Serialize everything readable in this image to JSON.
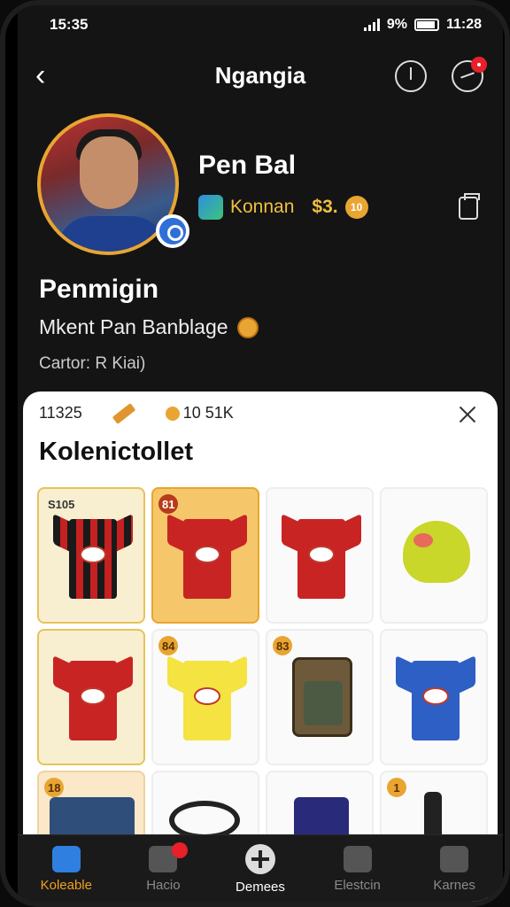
{
  "status": {
    "time": "15:35",
    "battery": "9%",
    "clock_right": "11:28"
  },
  "nav": {
    "title": "Ngangia"
  },
  "profile": {
    "name": "Pen Bal",
    "team": "Konnan",
    "coins": "$3.",
    "coin_value": "10",
    "display_name": "Penmigin",
    "bio": "Mkent Pan Banblage",
    "subtitle": "Cartor: R Kiai)"
  },
  "collection": {
    "count": "11325",
    "coins": "10 51K",
    "title": "Kolenictollet",
    "items": [
      {
        "badge": "S105",
        "kind": "jersey",
        "colors": "stripes",
        "tile": "gold"
      },
      {
        "badge": "81",
        "kind": "jersey",
        "colors": "red",
        "tile": "orange"
      },
      {
        "badge": "",
        "kind": "jersey",
        "colors": "red",
        "tile": "plain"
      },
      {
        "badge": "",
        "kind": "monster",
        "colors": "",
        "tile": "plain"
      },
      {
        "badge": "",
        "kind": "jersey",
        "colors": "red",
        "tile": "gold"
      },
      {
        "badge": "84",
        "kind": "jersey",
        "colors": "yellow",
        "tile": "plain"
      },
      {
        "badge": "83",
        "kind": "bag",
        "colors": "",
        "tile": "plain"
      },
      {
        "badge": "",
        "kind": "jersey",
        "colors": "blue",
        "tile": "plain"
      },
      {
        "badge": "18",
        "kind": "shorts",
        "colors": "",
        "tile": "peach"
      },
      {
        "badge": "",
        "kind": "cable",
        "colors": "",
        "tile": "plain"
      },
      {
        "badge": "",
        "kind": "bag2",
        "colors": "",
        "tile": "plain"
      },
      {
        "badge": "1",
        "kind": "bottle",
        "colors": "",
        "tile": "plain"
      }
    ]
  },
  "tabs": [
    {
      "label": "Koleable",
      "icon": "collection-icon",
      "active": true
    },
    {
      "label": "Hacio",
      "icon": "activity-icon",
      "active": false
    },
    {
      "label": "Demees",
      "icon": "add-icon",
      "active": false
    },
    {
      "label": "Elestcin",
      "icon": "inbox-icon",
      "active": false
    },
    {
      "label": "Karnes",
      "icon": "games-icon",
      "active": false
    }
  ],
  "colors": {
    "accent": "#f0a020",
    "brand_gold": "#e8a531",
    "background": "#141414"
  }
}
